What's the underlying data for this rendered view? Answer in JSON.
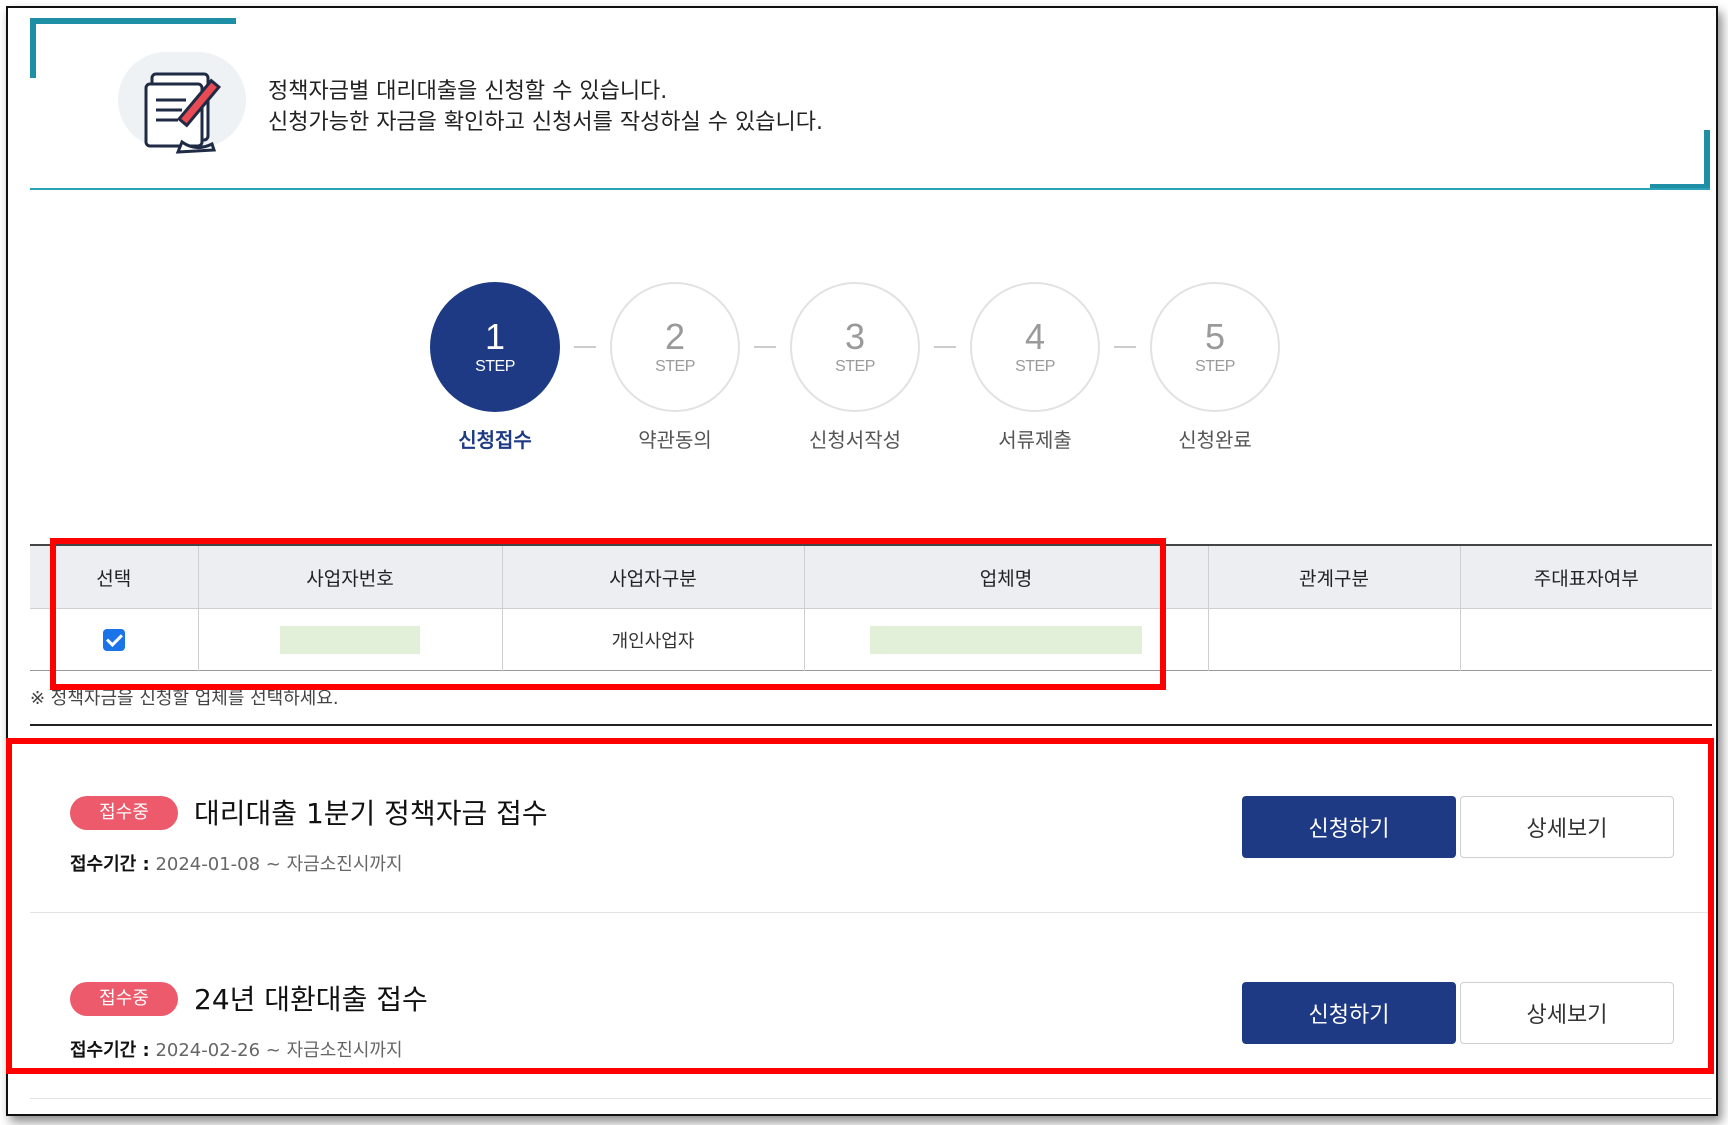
{
  "banner": {
    "line1": "정책자금별 대리대출을 신청할 수 있습니다.",
    "line2": "신청가능한 자금을 확인하고 신청서를 작성하실 수 있습니다.",
    "icon": "document-pen-icon"
  },
  "steps": [
    {
      "num": "1",
      "label": "STEP",
      "name": "신청접수",
      "active": true
    },
    {
      "num": "2",
      "label": "STEP",
      "name": "약관동의",
      "active": false
    },
    {
      "num": "3",
      "label": "STEP",
      "name": "신청서작성",
      "active": false
    },
    {
      "num": "4",
      "label": "STEP",
      "name": "서류제출",
      "active": false
    },
    {
      "num": "5",
      "label": "STEP",
      "name": "신청완료",
      "active": false
    }
  ],
  "table": {
    "headers": [
      "선택",
      "사업자번호",
      "사업자구분",
      "업체명",
      "관계구분",
      "주대표자여부"
    ],
    "row": {
      "checked": true,
      "biz_type": "개인사업자"
    }
  },
  "note": "※ 정책자금을 신청할 업체를 선택하세요.",
  "funds": [
    {
      "badge": "접수중",
      "title": "대리대출 1분기 정책자금 접수",
      "period_label": "접수기간 :",
      "period": "2024-01-08 ~ 자금소진시까지",
      "apply": "신청하기",
      "detail": "상세보기"
    },
    {
      "badge": "접수중",
      "title": "24년 대환대출 접수",
      "period_label": "접수기간 :",
      "period": "2024-02-26 ~ 자금소진시까지",
      "apply": "신청하기",
      "detail": "상세보기"
    }
  ],
  "colors": {
    "primary": "#1e3a84",
    "badge": "#ec5a6b",
    "accent": "#1e8fa5",
    "highlight": "#ff0000"
  }
}
